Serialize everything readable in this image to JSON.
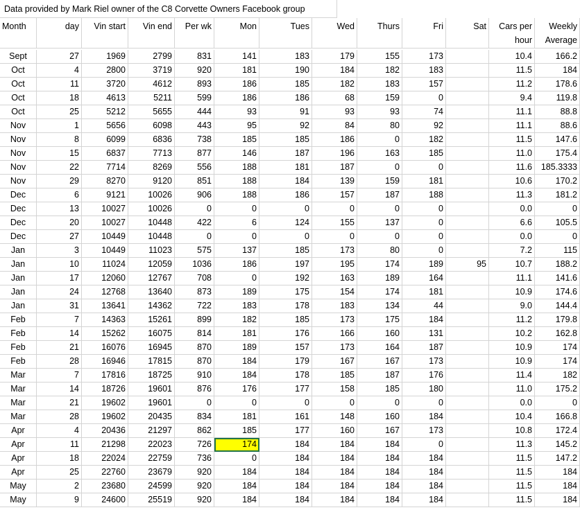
{
  "sheet": {
    "title": "Data provided by Mark Riel owner of the C8 Corvette Owners Facebook group",
    "headers": [
      "Month",
      "day",
      "Vin start",
      "Vin end",
      "Per wk",
      "Mon",
      "Tues",
      "Wed",
      "Thurs",
      "Fri",
      "Sat",
      "Cars per hour",
      "Weekly Average"
    ],
    "selected_cell": {
      "row": 28,
      "col": 5
    },
    "rows": [
      [
        "Sept",
        "27",
        "1969",
        "2799",
        "831",
        "141",
        "183",
        "179",
        "155",
        "173",
        "",
        "10.4",
        "166.2"
      ],
      [
        "Oct",
        "4",
        "2800",
        "3719",
        "920",
        "181",
        "190",
        "184",
        "182",
        "183",
        "",
        "11.5",
        "184"
      ],
      [
        "Oct",
        "11",
        "3720",
        "4612",
        "893",
        "186",
        "185",
        "182",
        "183",
        "157",
        "",
        "11.2",
        "178.6"
      ],
      [
        "Oct",
        "18",
        "4613",
        "5211",
        "599",
        "186",
        "186",
        "68",
        "159",
        "0",
        "",
        "9.4",
        "119.8"
      ],
      [
        "Oct",
        "25",
        "5212",
        "5655",
        "444",
        "93",
        "91",
        "93",
        "93",
        "74",
        "",
        "11.1",
        "88.8"
      ],
      [
        "Nov",
        "1",
        "5656",
        "6098",
        "443",
        "95",
        "92",
        "84",
        "80",
        "92",
        "",
        "11.1",
        "88.6"
      ],
      [
        "Nov",
        "8",
        "6099",
        "6836",
        "738",
        "185",
        "185",
        "186",
        "0",
        "182",
        "",
        "11.5",
        "147.6"
      ],
      [
        "Nov",
        "15",
        "6837",
        "7713",
        "877",
        "146",
        "187",
        "196",
        "163",
        "185",
        "",
        "11.0",
        "175.4"
      ],
      [
        "Nov",
        "22",
        "7714",
        "8269",
        "556",
        "188",
        "181",
        "187",
        "0",
        "0",
        "",
        "11.6",
        "185.3333"
      ],
      [
        "Nov",
        "29",
        "8270",
        "9120",
        "851",
        "188",
        "184",
        "139",
        "159",
        "181",
        "",
        "10.6",
        "170.2"
      ],
      [
        "Dec",
        "6",
        "9121",
        "10026",
        "906",
        "188",
        "186",
        "157",
        "187",
        "188",
        "",
        "11.3",
        "181.2"
      ],
      [
        "Dec",
        "13",
        "10027",
        "10026",
        "0",
        "0",
        "0",
        "0",
        "0",
        "0",
        "",
        "0.0",
        "0"
      ],
      [
        "Dec",
        "20",
        "10027",
        "10448",
        "422",
        "6",
        "124",
        "155",
        "137",
        "0",
        "",
        "6.6",
        "105.5"
      ],
      [
        "Dec",
        "27",
        "10449",
        "10448",
        "0",
        "0",
        "0",
        "0",
        "0",
        "0",
        "",
        "0.0",
        "0"
      ],
      [
        "Jan",
        "3",
        "10449",
        "11023",
        "575",
        "137",
        "185",
        "173",
        "80",
        "0",
        "",
        "7.2",
        "115"
      ],
      [
        "Jan",
        "10",
        "11024",
        "12059",
        "1036",
        "186",
        "197",
        "195",
        "174",
        "189",
        "95",
        "10.7",
        "188.2"
      ],
      [
        "Jan",
        "17",
        "12060",
        "12767",
        "708",
        "0",
        "192",
        "163",
        "189",
        "164",
        "",
        "11.1",
        "141.6"
      ],
      [
        "Jan",
        "24",
        "12768",
        "13640",
        "873",
        "189",
        "175",
        "154",
        "174",
        "181",
        "",
        "10.9",
        "174.6"
      ],
      [
        "Jan",
        "31",
        "13641",
        "14362",
        "722",
        "183",
        "178",
        "183",
        "134",
        "44",
        "",
        "9.0",
        "144.4"
      ],
      [
        "Feb",
        "7",
        "14363",
        "15261",
        "899",
        "182",
        "185",
        "173",
        "175",
        "184",
        "",
        "11.2",
        "179.8"
      ],
      [
        "Feb",
        "14",
        "15262",
        "16075",
        "814",
        "181",
        "176",
        "166",
        "160",
        "131",
        "",
        "10.2",
        "162.8"
      ],
      [
        "Feb",
        "21",
        "16076",
        "16945",
        "870",
        "189",
        "157",
        "173",
        "164",
        "187",
        "",
        "10.9",
        "174"
      ],
      [
        "Feb",
        "28",
        "16946",
        "17815",
        "870",
        "184",
        "179",
        "167",
        "167",
        "173",
        "",
        "10.9",
        "174"
      ],
      [
        "Mar",
        "7",
        "17816",
        "18725",
        "910",
        "184",
        "178",
        "185",
        "187",
        "176",
        "",
        "11.4",
        "182"
      ],
      [
        "Mar",
        "14",
        "18726",
        "19601",
        "876",
        "176",
        "177",
        "158",
        "185",
        "180",
        "",
        "11.0",
        "175.2"
      ],
      [
        "Mar",
        "21",
        "19602",
        "19601",
        "0",
        "0",
        "0",
        "0",
        "0",
        "0",
        "",
        "0.0",
        "0"
      ],
      [
        "Mar",
        "28",
        "19602",
        "20435",
        "834",
        "181",
        "161",
        "148",
        "160",
        "184",
        "",
        "10.4",
        "166.8"
      ],
      [
        "Apr",
        "4",
        "20436",
        "21297",
        "862",
        "185",
        "177",
        "160",
        "167",
        "173",
        "",
        "10.8",
        "172.4"
      ],
      [
        "Apr",
        "11",
        "21298",
        "22023",
        "726",
        "174",
        "184",
        "184",
        "184",
        "0",
        "",
        "11.3",
        "145.2"
      ],
      [
        "Apr",
        "18",
        "22024",
        "22759",
        "736",
        "0",
        "184",
        "184",
        "184",
        "184",
        "",
        "11.5",
        "147.2"
      ],
      [
        "Apr",
        "25",
        "22760",
        "23679",
        "920",
        "184",
        "184",
        "184",
        "184",
        "184",
        "",
        "11.5",
        "184"
      ],
      [
        "May",
        "2",
        "23680",
        "24599",
        "920",
        "184",
        "184",
        "184",
        "184",
        "184",
        "",
        "11.5",
        "184"
      ],
      [
        "May",
        "9",
        "24600",
        "25519",
        "920",
        "184",
        "184",
        "184",
        "184",
        "184",
        "",
        "11.5",
        "184"
      ]
    ]
  }
}
